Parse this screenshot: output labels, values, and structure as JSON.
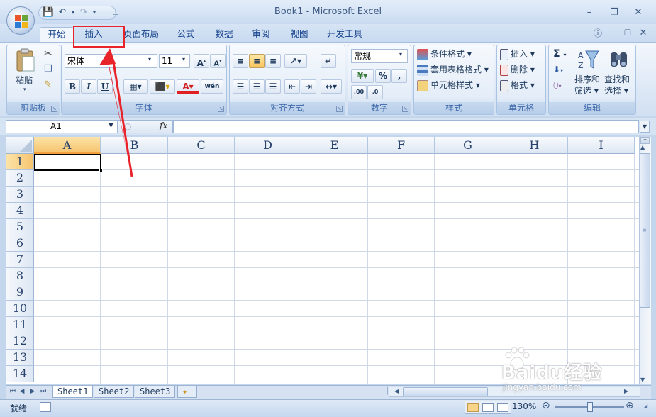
{
  "window": {
    "title": "Book1 - Microsoft Excel"
  },
  "ribbon_tabs": [
    {
      "label": "开始",
      "active": true
    },
    {
      "label": "插入",
      "highlighted": true
    },
    {
      "label": "页面布局"
    },
    {
      "label": "公式"
    },
    {
      "label": "数据"
    },
    {
      "label": "审阅"
    },
    {
      "label": "视图"
    },
    {
      "label": "开发工具"
    }
  ],
  "groups": {
    "clipboard": {
      "label": "剪贴板",
      "paste": "粘贴"
    },
    "font": {
      "label": "字体",
      "font_name": "宋体",
      "font_size": "11",
      "bold": "B",
      "italic": "I",
      "underline": "U",
      "font_color": "A",
      "phonetic": "wén"
    },
    "alignment": {
      "label": "对齐方式"
    },
    "number": {
      "label": "数字",
      "format": "常规",
      "percent": "%",
      "comma": ","
    },
    "styles": {
      "label": "样式",
      "conditional": "条件格式",
      "table_format": "套用表格格式",
      "cell_styles": "单元格样式"
    },
    "cells": {
      "label": "单元格",
      "insert": "插入",
      "delete": "删除",
      "format": "格式"
    },
    "editing": {
      "label": "编辑",
      "sort": "排序和\n筛选",
      "sort1": "排序和",
      "sort2": "筛选",
      "find1": "查找和",
      "find2": "选择",
      "sum": "Σ"
    }
  },
  "formula_bar": {
    "name_box": "A1",
    "fx": "fx",
    "value": ""
  },
  "columns": [
    "A",
    "B",
    "C",
    "D",
    "E",
    "F",
    "G",
    "H",
    "I"
  ],
  "rows": [
    "1",
    "2",
    "3",
    "4",
    "5",
    "6",
    "7",
    "8",
    "9",
    "10",
    "11",
    "12",
    "13",
    "14"
  ],
  "active_cell": "A1",
  "sheets": [
    {
      "label": "Sheet1",
      "active": true
    },
    {
      "label": "Sheet2"
    },
    {
      "label": "Sheet3"
    }
  ],
  "status": {
    "ready": "就绪",
    "zoom": "130%"
  },
  "watermark": {
    "brand": "Baidu经验",
    "url": "jingyan.baidu.com"
  },
  "colors": {
    "accent": "#f6c46e",
    "annotation": "#e8232a",
    "ribbon": "#dfe9f6"
  }
}
